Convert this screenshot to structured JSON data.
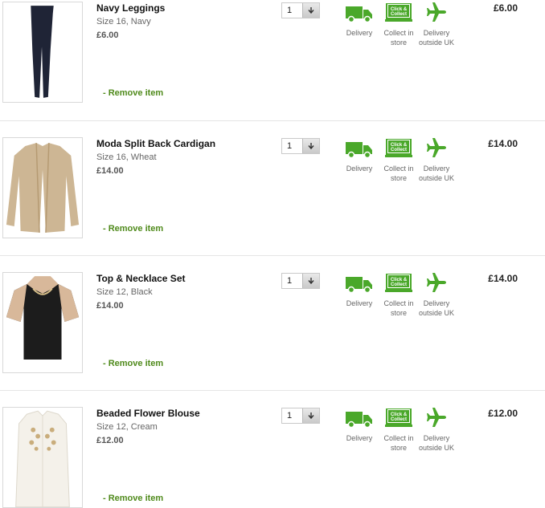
{
  "colors": {
    "accent_green": "#4f8a1b",
    "icon_green": "#4aa82a"
  },
  "items": [
    {
      "name": "Navy Leggings",
      "size_label": "Size 16,",
      "colour": "Navy",
      "unit_price": "£6.00",
      "quantity": "1",
      "total": "£6.00",
      "remove_label": "- Remove item",
      "delivery_label": "Delivery",
      "collect_label": "Collect in store",
      "outside_label": "Delivery outside UK",
      "icon": "leggings-image"
    },
    {
      "name": "Moda Split Back Cardigan",
      "size_label": "Size 16,",
      "colour": "Wheat",
      "unit_price": "£14.00",
      "quantity": "1",
      "total": "£14.00",
      "remove_label": "- Remove item",
      "delivery_label": "Delivery",
      "collect_label": "Collect in store",
      "outside_label": "Delivery outside UK",
      "icon": "cardigan-image"
    },
    {
      "name": "Top & Necklace Set",
      "size_label": "Size 12,",
      "colour": "Black",
      "unit_price": "£14.00",
      "quantity": "1",
      "total": "£14.00",
      "remove_label": "- Remove item",
      "delivery_label": "Delivery",
      "collect_label": "Collect in store",
      "outside_label": "Delivery outside UK",
      "icon": "top-necklace-image"
    },
    {
      "name": "Beaded Flower Blouse",
      "size_label": "Size 12,",
      "colour": "Cream",
      "unit_price": "£12.00",
      "quantity": "1",
      "total": "£12.00",
      "remove_label": "- Remove item",
      "delivery_label": "Delivery",
      "collect_label": "Collect in store",
      "outside_label": "Delivery outside UK",
      "icon": "blouse-image"
    }
  ],
  "collect_badge_text": "Click & Collect"
}
